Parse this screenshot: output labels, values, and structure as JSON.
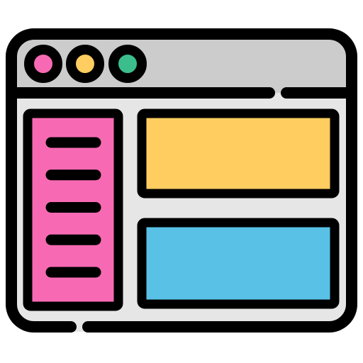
{
  "icon": {
    "semantic": "browser-window-layout-icon",
    "colors": {
      "outline": "#000000",
      "title_bar": "#cccccc",
      "window_body": "#e6e6e6",
      "control_close": "#f76ab3",
      "control_minimize": "#ffcd60",
      "control_maximize": "#3bbe8c",
      "sidebar": "#f76ab3",
      "top_panel": "#ffcd60",
      "bottom_panel": "#59c1e6"
    },
    "sidebar_line_count": 5
  }
}
